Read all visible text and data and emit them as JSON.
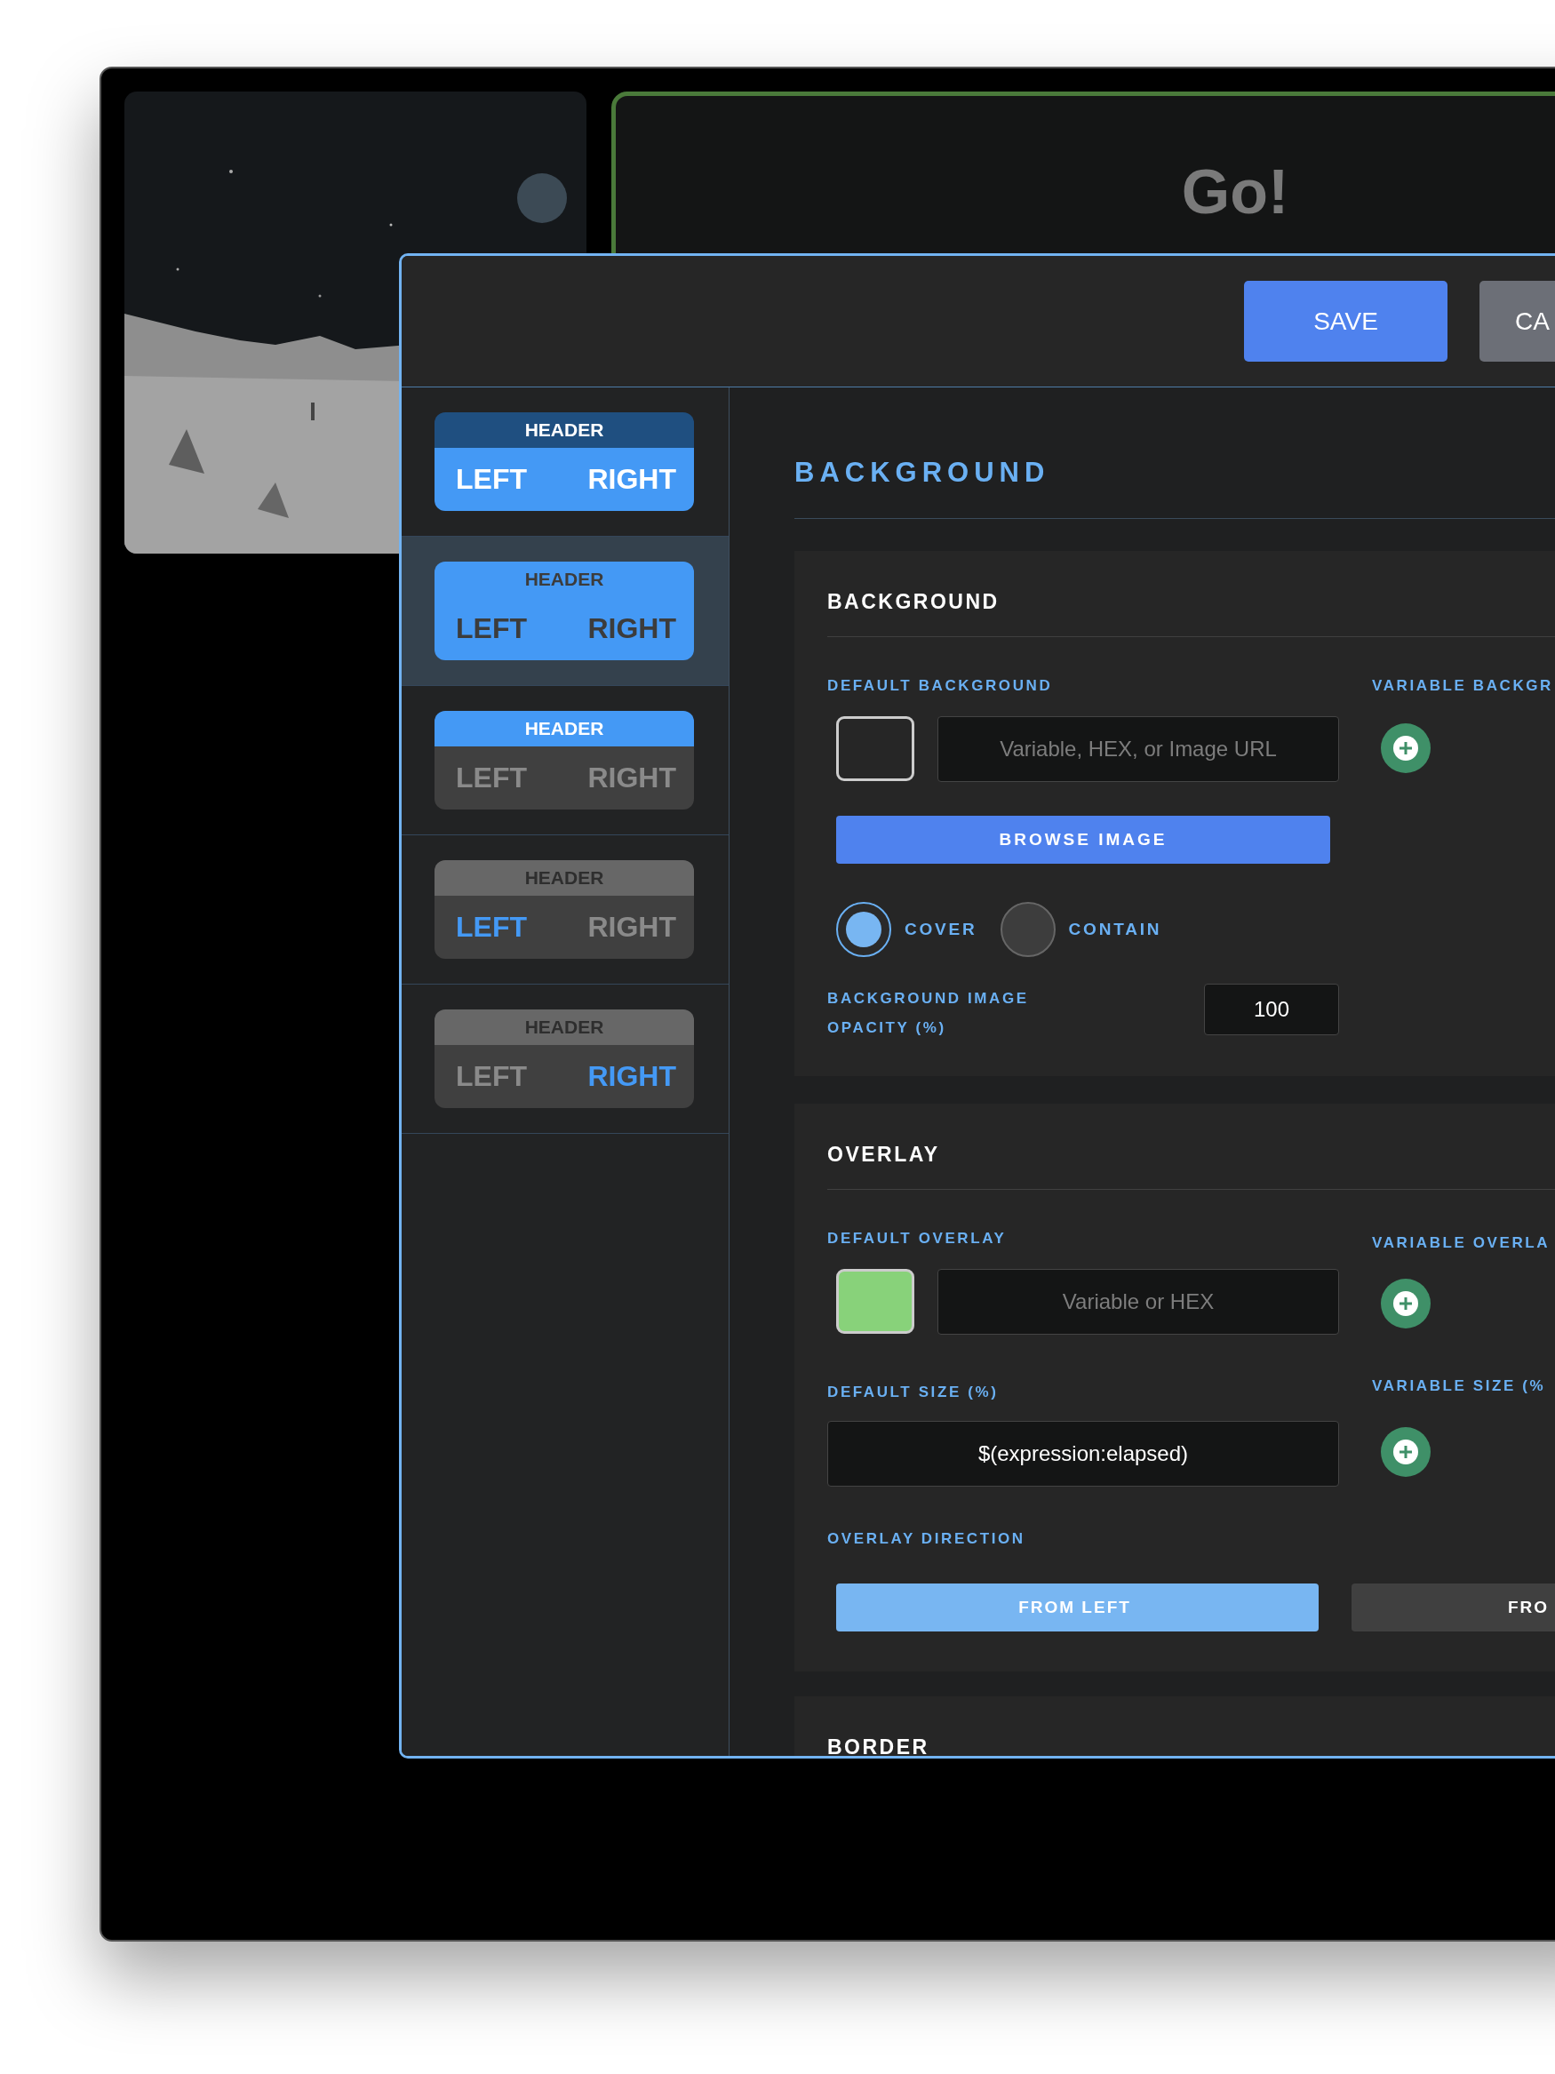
{
  "preview": {
    "title": "Go!"
  },
  "modal": {
    "buttons": [
      {
        "label": "SAVE",
        "kind": "primary"
      },
      {
        "label": "CA",
        "kind": "secondary"
      }
    ]
  },
  "layouts": [
    {
      "header": "HEADER",
      "left": "LEFT",
      "right": "RIGHT",
      "background_on": true,
      "header_on": true,
      "left_on": true,
      "right_on": true,
      "selected": false
    },
    {
      "header": "HEADER",
      "left": "LEFT",
      "right": "RIGHT",
      "background_on": true,
      "header_on": false,
      "left_on": false,
      "right_on": false,
      "selected": true
    },
    {
      "header": "HEADER",
      "left": "LEFT",
      "right": "RIGHT",
      "background_on": false,
      "header_on": true,
      "left_on": false,
      "right_on": false,
      "selected": false
    },
    {
      "header": "HEADER",
      "left": "LEFT",
      "right": "RIGHT",
      "background_on": false,
      "header_on": false,
      "left_on": true,
      "right_on": false,
      "selected": false
    },
    {
      "header": "HEADER",
      "left": "LEFT",
      "right": "RIGHT",
      "background_on": false,
      "header_on": false,
      "left_on": false,
      "right_on": true,
      "selected": false
    }
  ],
  "page_title": "BACKGROUND",
  "background_section": {
    "title": "BACKGROUND",
    "default_label": "DEFAULT BACKGROUND",
    "color": "#262626",
    "placeholder": "Variable, HEX, or Image URL",
    "variable_label": "VARIABLE BACKGR",
    "browse_button": "BROWSE IMAGE",
    "fit_options": [
      {
        "label": "COVER",
        "selected": true
      },
      {
        "label": "CONTAIN",
        "selected": false
      }
    ],
    "opacity_label": "BACKGROUND IMAGE OPACITY (%)",
    "opacity_value": "100"
  },
  "overlay_section": {
    "title": "OVERLAY",
    "default_label": "DEFAULT OVERLAY",
    "color": "#88d27a",
    "placeholder": "Variable or HEX",
    "variable_label": "VARIABLE OVERLA",
    "size_label": "DEFAULT SIZE (%)",
    "size_value": "$(expression:elapsed)",
    "variable_size_label": "VARIABLE SIZE (%",
    "direction_label": "OVERLAY DIRECTION",
    "directions": [
      {
        "label": "FROM LEFT",
        "selected": true
      },
      {
        "label": "FRO",
        "selected": false
      }
    ]
  },
  "border_section": {
    "title": "BORDER"
  }
}
